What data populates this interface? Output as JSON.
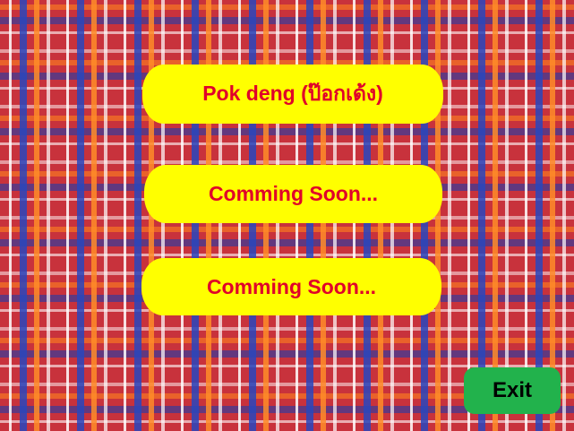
{
  "menu": {
    "items": [
      {
        "label": "Pok deng (ป๊อกเด้ง)"
      },
      {
        "label": "Comming Soon..."
      },
      {
        "label": "Comming Soon..."
      }
    ]
  },
  "exit": {
    "label": "Exit"
  },
  "colors": {
    "menu_bg": "#ffff00",
    "menu_text": "#e0002a",
    "exit_bg": "#22b24c",
    "exit_text": "#000000"
  }
}
